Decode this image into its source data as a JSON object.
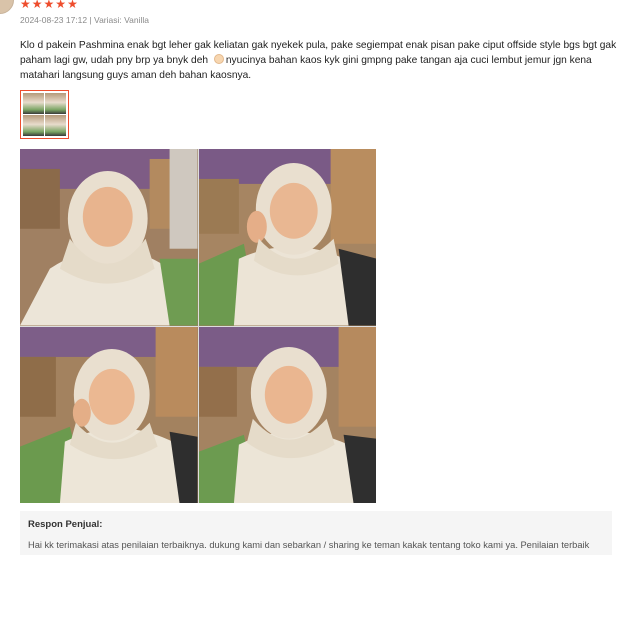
{
  "review": {
    "rating": 5,
    "date_variant": "2024-08-23 17:12 | Variasi: Vanilla",
    "text_part1": "Klo d pakein Pashmina enak bgt leher gak keliatan gak nyekek pula, pake segiempat enak pisan pake ciput offside style bgs bgt gak paham lagi gw, udah pny brp ya bnyk deh ",
    "text_part2": "nyucinya bahan kaos kyk gini gmpng pake tangan aja cuci lembut jemur jgn kena matahari langsung guys aman deh bahan kaosnya.",
    "emoji": "smiling-face-emoji",
    "media_count": 1
  },
  "seller_response": {
    "title": "Respon Penjual:",
    "text": "Hai kk terimakasi atas penilaian terbaiknya. dukung kami dan sebarkan / sharing ke teman kakak tentang toko kami ya. Penilaian terbaik kakak sangat berarti. Makasihh"
  },
  "colors": {
    "star": "#ee4d2d",
    "meta": "#8a8a8a",
    "response_bg": "#f5f5f5"
  }
}
